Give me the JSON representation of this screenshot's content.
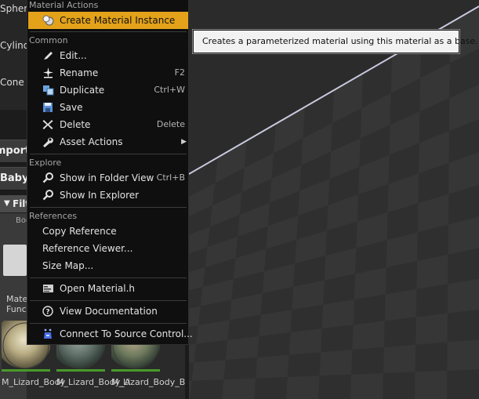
{
  "left_panel": {
    "modes": [
      "Sphere",
      "Cylinder",
      "Cone"
    ],
    "toolbar_import": "Import",
    "breadcrumb": "Baby_",
    "filter_label": "Filters",
    "folder_label_short": "Boo",
    "material_func_label": "Material Functions",
    "assets": [
      {
        "name": "M_Lizard_Body"
      },
      {
        "name": "M_Lizard_Body_A"
      },
      {
        "name": "M_Lizard_Body_B"
      }
    ]
  },
  "context_menu": {
    "sections": {
      "material_actions": "Material Actions",
      "common": "Common",
      "explore": "Explore",
      "references": "References"
    },
    "items": {
      "create_instance": {
        "label": "Create Material Instance",
        "icon": "material-instance-icon"
      },
      "edit": {
        "label": "Edit...",
        "icon": "edit-icon"
      },
      "rename": {
        "label": "Rename",
        "shortcut": "F2",
        "icon": "rename-icon"
      },
      "duplicate": {
        "label": "Duplicate",
        "shortcut": "Ctrl+W",
        "icon": "duplicate-icon"
      },
      "save": {
        "label": "Save",
        "icon": "save-icon"
      },
      "delete": {
        "label": "Delete",
        "shortcut": "Delete",
        "icon": "delete-icon"
      },
      "asset_actions": {
        "label": "Asset Actions",
        "icon": "wrench-icon"
      },
      "show_folder": {
        "label": "Show in Folder View",
        "shortcut": "Ctrl+B",
        "icon": "search-icon"
      },
      "show_explorer": {
        "label": "Show In Explorer",
        "icon": "search-icon"
      },
      "copy_reference": {
        "label": "Copy Reference"
      },
      "reference_viewer": {
        "label": "Reference Viewer..."
      },
      "size_map": {
        "label": "Size Map..."
      },
      "open_header": {
        "label": "Open Material.h",
        "icon": "code-file-icon"
      },
      "view_docs": {
        "label": "View Documentation",
        "icon": "help-icon"
      },
      "source_control": {
        "label": "Connect To Source Control...",
        "icon": "source-control-icon"
      }
    }
  },
  "tooltip": {
    "text": "Creates a parameterized material using this material as a base."
  },
  "colors": {
    "highlight": "#e3a21a",
    "menu_bg": "#0f0f0f",
    "tooltip_bg": "#f2f2f2"
  }
}
